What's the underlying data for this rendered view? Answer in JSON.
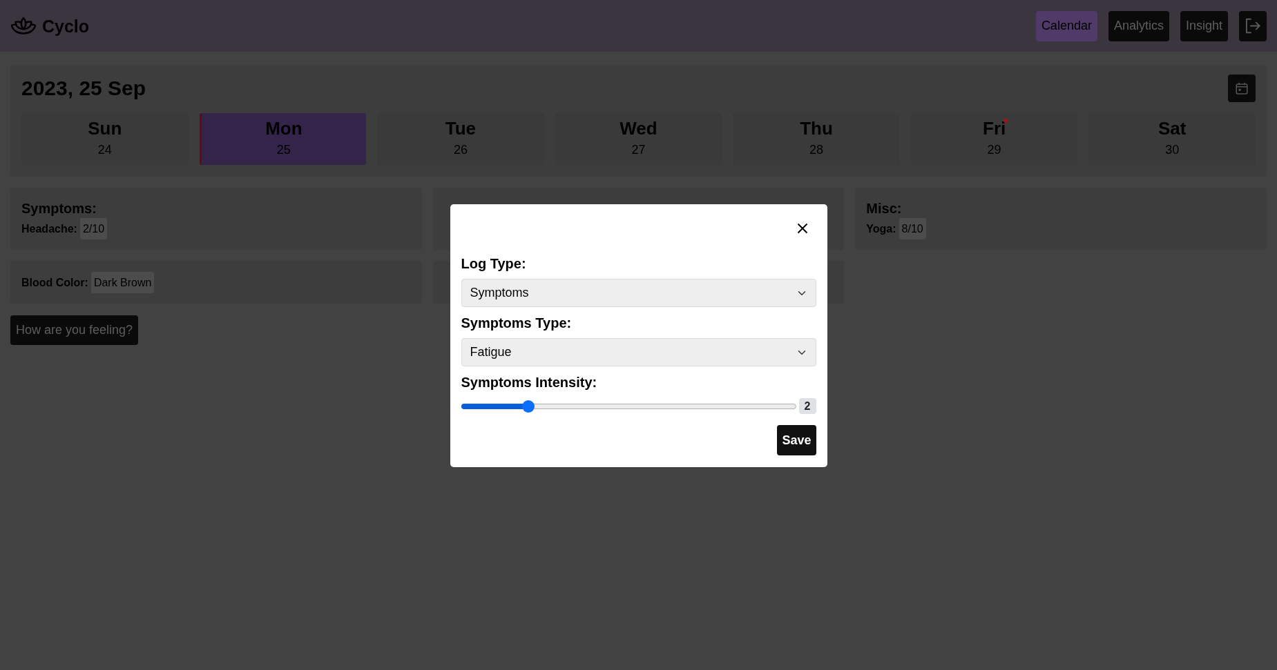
{
  "navbar": {
    "brand": "Cyclo",
    "links": [
      {
        "label": "Calendar",
        "selected": true
      },
      {
        "label": "Analytics",
        "selected": false
      },
      {
        "label": "Insight",
        "selected": false
      }
    ]
  },
  "calendar": {
    "title": "2023, 25 Sep",
    "days": [
      {
        "day": "Sun",
        "date": "24",
        "selected": false,
        "marked": false
      },
      {
        "day": "Mon",
        "date": "25",
        "selected": true,
        "marked": false
      },
      {
        "day": "Tue",
        "date": "26",
        "selected": false,
        "marked": false
      },
      {
        "day": "Wed",
        "date": "27",
        "selected": false,
        "marked": false
      },
      {
        "day": "Thu",
        "date": "28",
        "selected": false,
        "marked": false
      },
      {
        "day": "Fri",
        "date": "29",
        "selected": false,
        "marked": true
      },
      {
        "day": "Sat",
        "date": "30",
        "selected": false,
        "marked": false
      }
    ]
  },
  "log_cards": [
    {
      "kind": "log",
      "title": "Symptoms:",
      "entries": [
        {
          "label": "Headache:",
          "value": "2/10"
        }
      ]
    },
    {
      "kind": "hidden"
    },
    {
      "kind": "log",
      "title": "Misc:",
      "entries": [
        {
          "label": "Yoga:",
          "value": "8/10"
        }
      ]
    },
    {
      "kind": "log",
      "entries": [
        {
          "label": "Blood Color:",
          "value": "Dark Brown"
        }
      ]
    },
    {
      "kind": "hidden"
    }
  ],
  "feeling_button": "How are you feeling?",
  "modal": {
    "fields": [
      {
        "kind": "select",
        "label": "Log Type:",
        "value": "Symptoms"
      },
      {
        "kind": "select",
        "label": "Symptoms Type:",
        "value": "Fatigue"
      },
      {
        "kind": "range",
        "label": "Symptoms Intensity:",
        "level": 0.2,
        "reading": "2"
      }
    ],
    "save_button": "Save"
  }
}
